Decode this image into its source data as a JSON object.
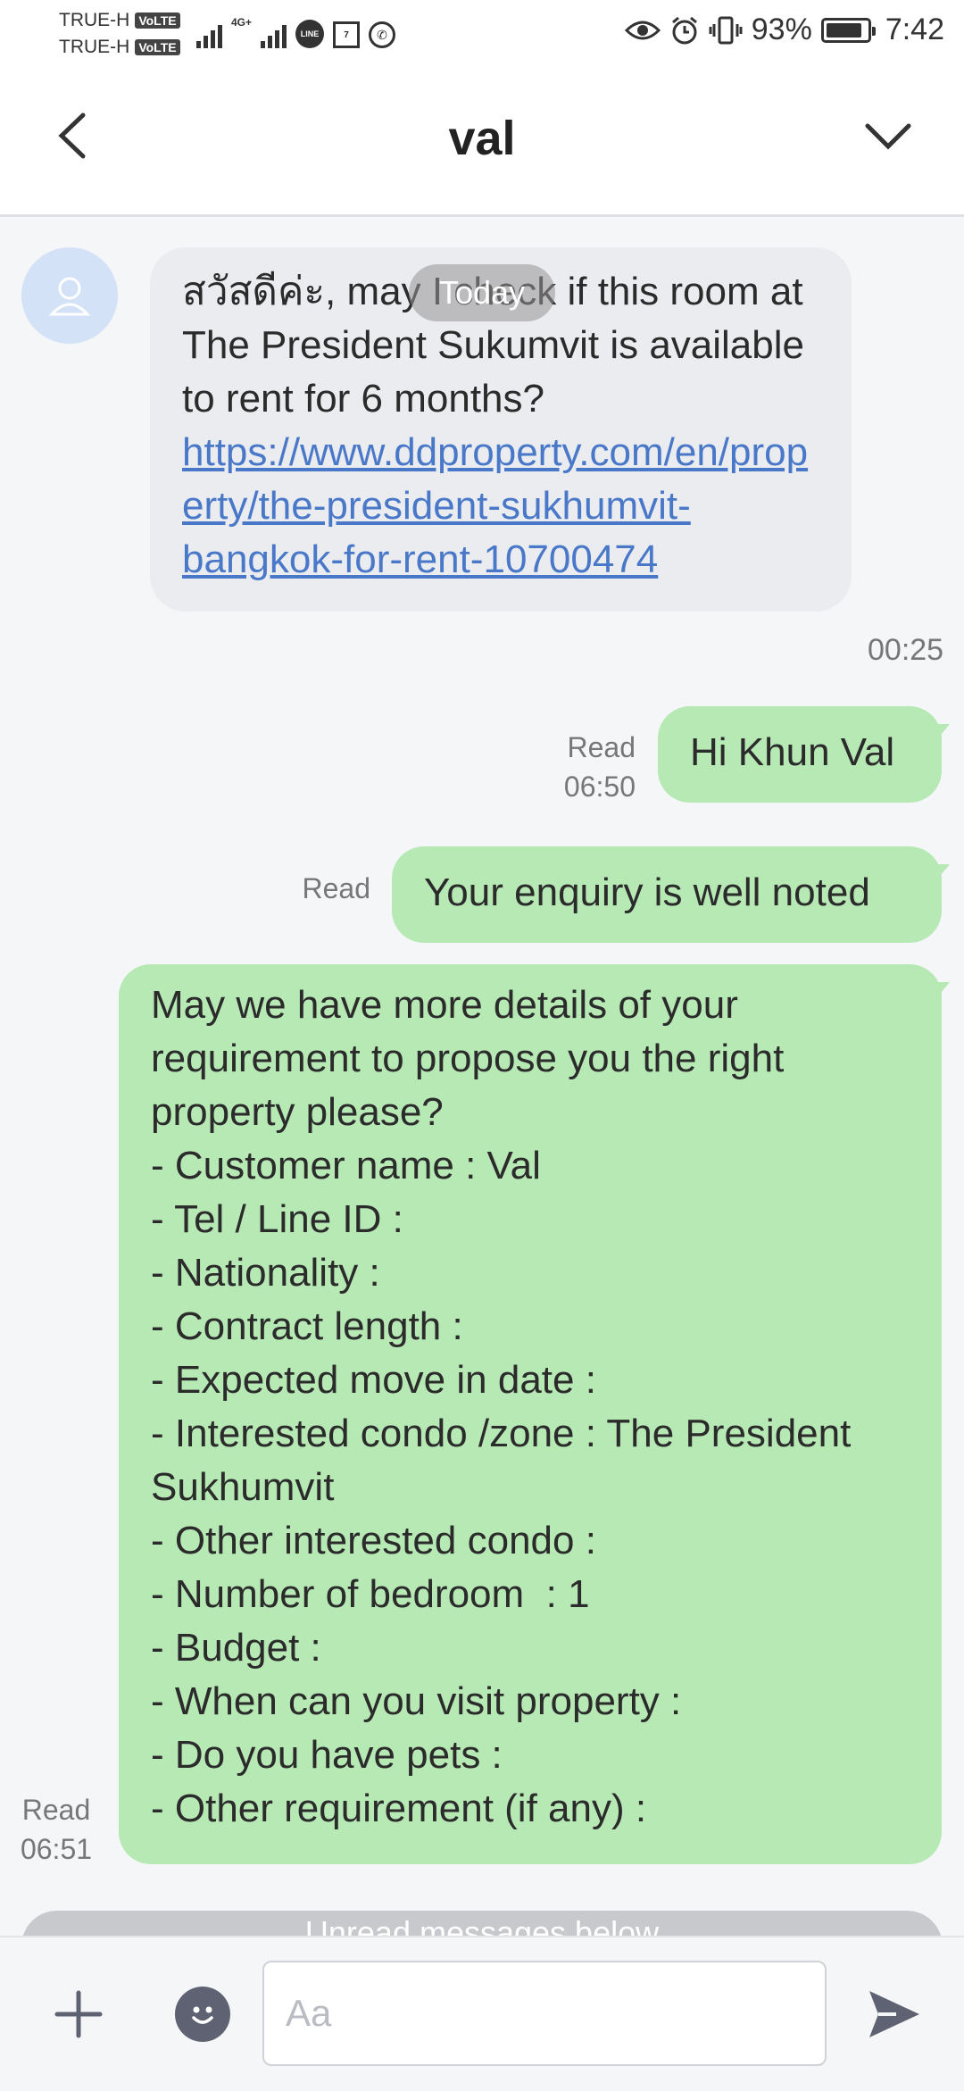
{
  "status_bar": {
    "carrier_1": "TRUE-H",
    "carrier_2": "TRUE-H",
    "volte_badge": "VoLTE",
    "network": "4G+",
    "line_icon_text": "LINE",
    "seven_icon_text": "7",
    "battery": "93%",
    "time": "7:42"
  },
  "header": {
    "title": "val"
  },
  "chat": {
    "date_pill": "Today",
    "incoming_message": {
      "text": "สวัสดีค่ะ, may I check if this room at The President Sukumvit is available to rent for 6 months? ",
      "link": "https://www.ddproperty.com/en/property/the-president-sukhumvit-bangkok-for-rent-10700474",
      "time": "00:25"
    },
    "outgoing_1": {
      "text": "Hi Khun Val",
      "status": "Read",
      "time": "06:50"
    },
    "outgoing_2": {
      "text": "Your enquiry is well noted",
      "status": "Read"
    },
    "outgoing_3": {
      "text": "May we have more details of your requirement to propose you the right property please?\n- Customer name : Val\n- Tel / Line ID :\n- Nationality :\n- Contract length :\n- Expected move in date :\n- Interested condo /zone : The President Sukhumvit\n- Other interested condo :\n- Number of bedroom  : 1\n- Budget :\n- When can you visit property :\n- Do you have pets :\n- Other requirement (if any) :",
      "status": "Read",
      "time": "06:51"
    },
    "unread_bar": "Unread messages below"
  },
  "input_bar": {
    "placeholder": "Aa"
  },
  "colors": {
    "outgoing_bubble": "#b7e9b5",
    "incoming_bubble": "#eaecef",
    "link": "#4a78c9",
    "chat_bg": "#f5f6f8"
  }
}
